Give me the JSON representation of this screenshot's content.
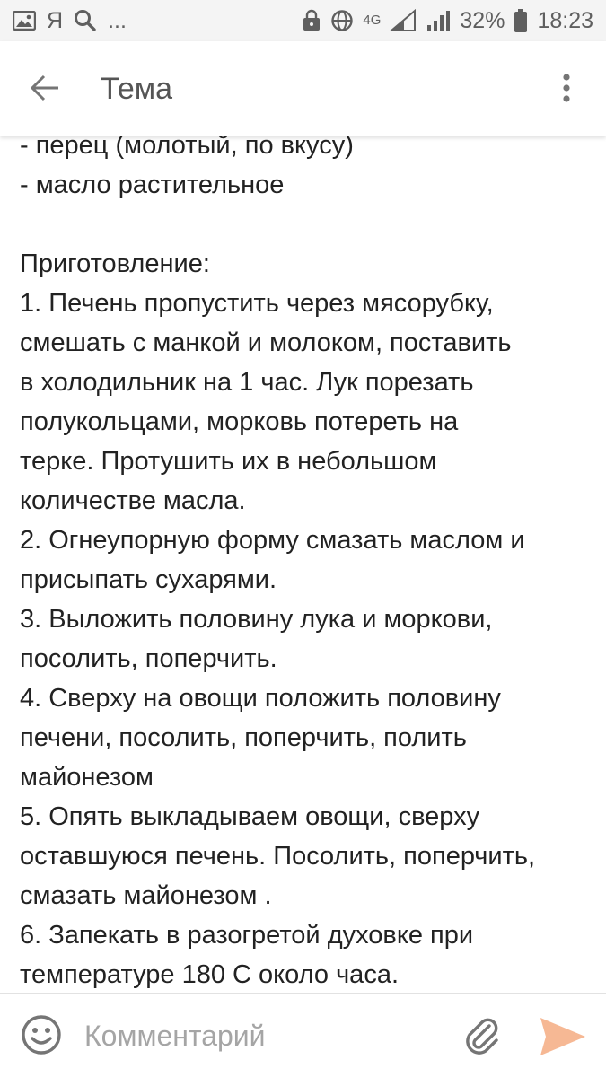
{
  "status_bar": {
    "carrier_glyph": "Я",
    "more": "...",
    "network": "4G",
    "battery": "32%",
    "time": "18:23",
    "icons": [
      "image-icon",
      "search-icon",
      "lock-icon",
      "globe-icon",
      "signal-icon",
      "signal-icon",
      "battery-icon"
    ]
  },
  "app_bar": {
    "title": "Тема",
    "icons": [
      "back-arrow-icon",
      "more-vertical-icon"
    ]
  },
  "content": {
    "lines": [
      "- перец (молотый, по вкусу)",
      "- масло растительное",
      "",
      "Приготовление:",
      "1. Печень пропустить через мясорубку,",
      "смешать с манкой и молоком, поставить",
      "в холодильник на 1 час. Лук порезать",
      "полукольцами, морковь потереть на",
      "терке. Протушить их в небольшом",
      "количестве масла.",
      "2. Огнеупорную форму смазать маслом и",
      "присыпать сухарями.",
      "3. Выложить половину лука и моркови,",
      "посолить, поперчить.",
      "4. Сверху на овощи положить половину",
      "печени, посолить, поперчить, полить",
      "майонезом",
      "5. Опять выкладываем овощи, сверху",
      "оставшуюся печень. Посолить, поперчить,",
      "смазать майонезом .",
      "6. Запекать в разогретой духовке при",
      "температуре 180 С около часа."
    ]
  },
  "comment_bar": {
    "placeholder": "Комментарий",
    "value": "",
    "icons": [
      "emoji-icon",
      "paperclip-icon",
      "send-icon"
    ]
  },
  "colors": {
    "status_bar_bg": "#f4f4f4",
    "status_text": "#5f5f5f",
    "title_text": "#555555",
    "body_text": "#222222",
    "placeholder": "#a5a5a5",
    "send_accent": "#f6b894",
    "icon_gray": "#757575"
  }
}
